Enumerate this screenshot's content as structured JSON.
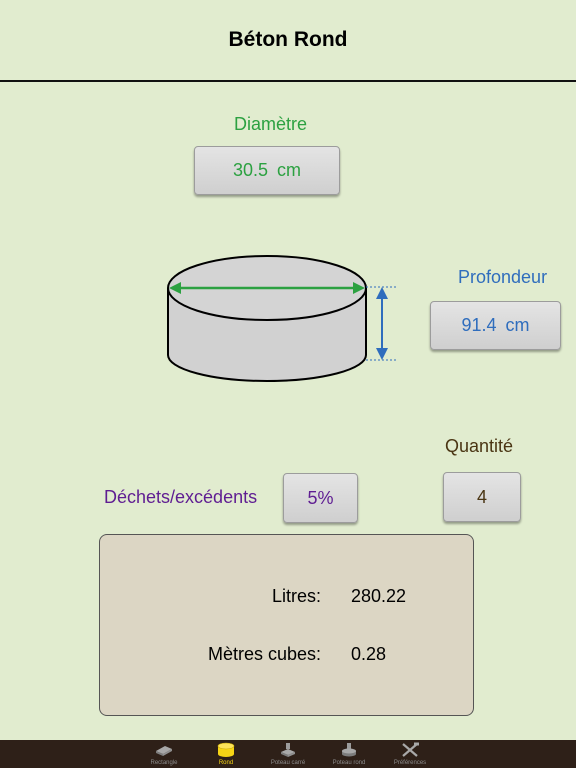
{
  "header": {
    "title": "Béton Rond"
  },
  "diameter": {
    "label": "Diamètre",
    "value": "30.5",
    "unit": "cm"
  },
  "depth": {
    "label": "Profondeur",
    "value": "91.4",
    "unit": "cm"
  },
  "quantity": {
    "label": "Quantité",
    "value": "4"
  },
  "waste": {
    "label": "Déchets/excédents",
    "value": "5%"
  },
  "results": {
    "liters_label": "Litres:",
    "liters_value": "280.22",
    "cubic_label": "Mètres cubes:",
    "cubic_value": "0.28"
  },
  "tabs": [
    {
      "label": "Rectangle",
      "icon": "rectangle-slab-icon",
      "active": false
    },
    {
      "label": "Rond",
      "icon": "cylinder-icon",
      "active": true
    },
    {
      "label": "Poteau carré",
      "icon": "square-post-icon",
      "active": false
    },
    {
      "label": "Poteau rond",
      "icon": "round-post-icon",
      "active": false
    },
    {
      "label": "Préférences",
      "icon": "tools-icon",
      "active": false
    }
  ],
  "colors": {
    "background": "#e1eccf",
    "diameter": "#2ca141",
    "depth": "#2f6dbd",
    "quantity": "#4a3513",
    "waste": "#5f1d92",
    "results_bg": "#dcd6c4",
    "tabbar": "#2e2018",
    "active_tab": "#f7d515"
  }
}
